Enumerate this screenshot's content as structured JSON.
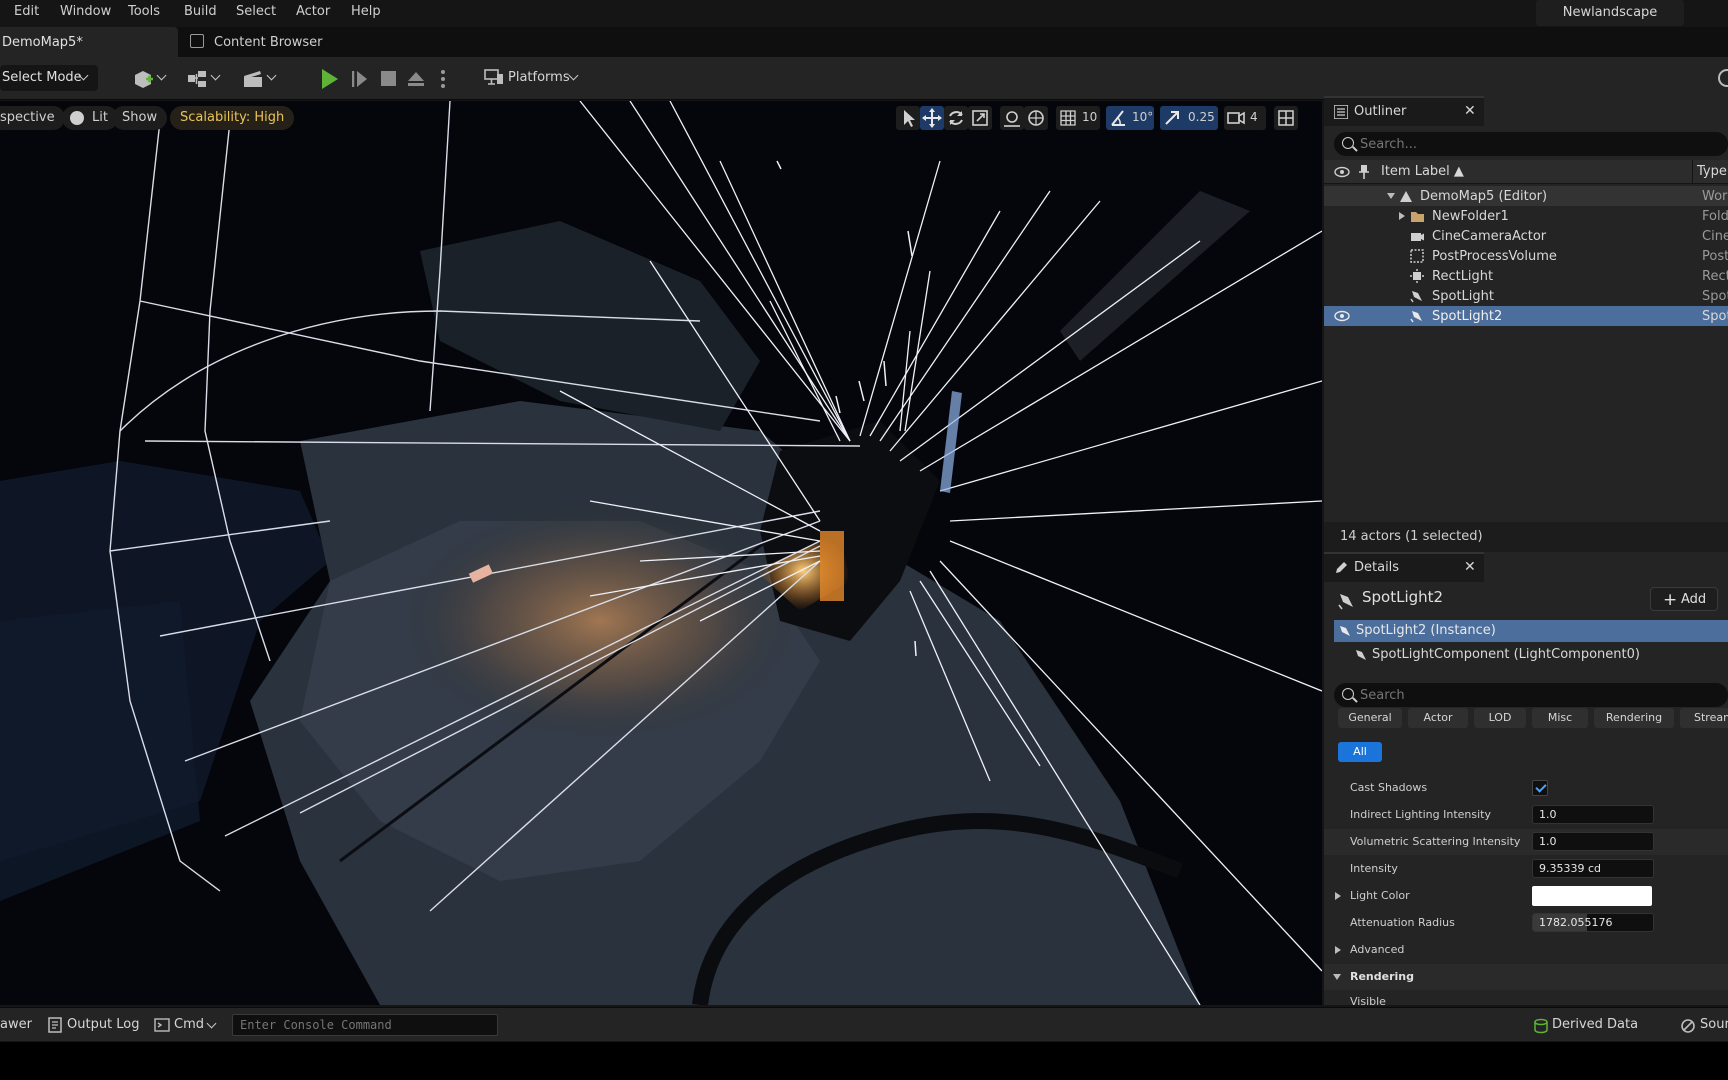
{
  "menu": [
    "Edit",
    "Window",
    "Tools",
    "Build",
    "Select",
    "Actor",
    "Help"
  ],
  "project_name": "Newlandscape",
  "tabs": {
    "level": "DemoMap5*",
    "content_browser": "Content Browser"
  },
  "toolbar": {
    "select_mode": "Select Mode",
    "platforms": "Platforms"
  },
  "viewport": {
    "view_mode": "Perspective",
    "perspective_visible": "spective",
    "lit": "Lit",
    "show": "Show",
    "scalability": "Scalability: High",
    "grid_snap": "10",
    "rotation_snap": "10°",
    "scale_snap": "0.25",
    "camera_speed": "4"
  },
  "outliner": {
    "title": "Outliner",
    "search_placeholder": "Search...",
    "col_label": "Item Label ▲",
    "col_type": "Type",
    "rows": [
      {
        "label": "DemoMap5 (Editor)",
        "type": "World",
        "icon": "level-icon"
      },
      {
        "label": "NewFolder1",
        "type": "Folder",
        "icon": "folder-icon"
      },
      {
        "label": "CineCameraActor",
        "type": "CineCameraActor",
        "icon": "camera-icon"
      },
      {
        "label": "PostProcessVolume",
        "type": "PostProcessVolume",
        "icon": "volume-icon"
      },
      {
        "label": "RectLight",
        "type": "RectLight",
        "icon": "rectlight-icon"
      },
      {
        "label": "SpotLight",
        "type": "SpotLight",
        "icon": "spotlight-icon"
      },
      {
        "label": "SpotLight2",
        "type": "SpotLight",
        "icon": "spotlight-icon",
        "selected": true
      }
    ],
    "status": "14 actors (1 selected)"
  },
  "details": {
    "title": "Details",
    "actor_name": "SpotLight2",
    "add_label": "Add",
    "instance": "SpotLight2 (Instance)",
    "component": "SpotLightComponent (LightComponent0)",
    "search_placeholder": "Search",
    "filters": [
      "General",
      "Actor",
      "LOD",
      "Misc",
      "Rendering",
      "Streaming"
    ],
    "filter_all": "All",
    "props": {
      "cast_shadows": "Cast Shadows",
      "indirect_label": "Indirect Lighting Intensity",
      "indirect_value": "1.0",
      "volumetric_label": "Volumetric Scattering Intensity",
      "volumetric_value": "1.0",
      "intensity_label": "Intensity",
      "intensity_value": "9.35339 cd",
      "light_color_label": "Light Color",
      "light_color_value": "#ffffff",
      "attenuation_label": "Attenuation Radius",
      "attenuation_value": "1782.055176",
      "advanced": "Advanced",
      "rendering": "Rendering",
      "visible": "Visible"
    }
  },
  "statusbar": {
    "drawer": "Content Drawer",
    "drawer_visible": "awer",
    "output_log": "Output Log",
    "cmd": "Cmd",
    "console_placeholder": "Enter Console Command",
    "derived_data": "Derived Data",
    "source_control": "Source Control",
    "source_visible": "Sour"
  },
  "colors": {
    "accent": "#1a74d9",
    "selection": "#4c6e9c",
    "play": "#5fb437",
    "scalability": "#e8c35a"
  }
}
